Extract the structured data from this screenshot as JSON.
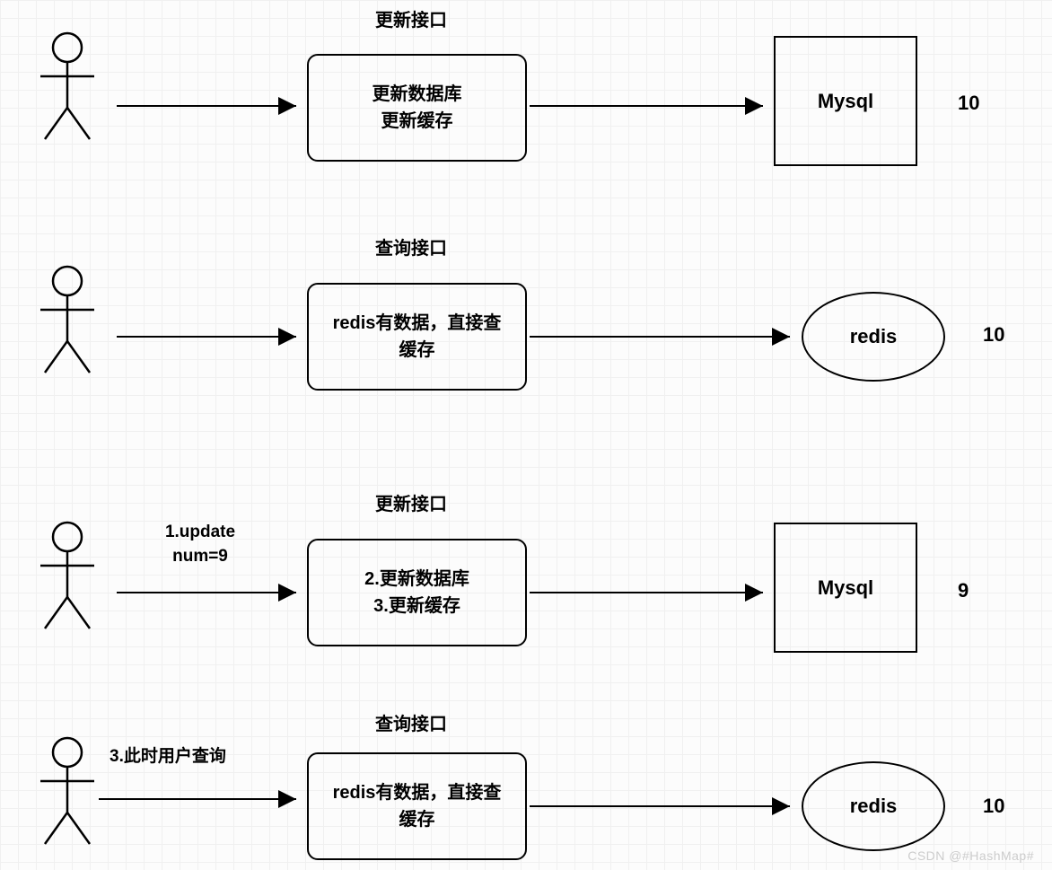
{
  "row1": {
    "title": "更新接口",
    "box": "更新数据库\n更新缓存",
    "target": "Mysql",
    "value": "10"
  },
  "row2": {
    "title": "查询接口",
    "box": "redis有数据，直接查\n缓存",
    "target": "redis",
    "value": "10"
  },
  "row3": {
    "title": "更新接口",
    "arrow_label": "1.update\nnum=9",
    "box": "2.更新数据库\n3.更新缓存",
    "target": "Mysql",
    "value": "9"
  },
  "row4": {
    "title": "查询接口",
    "arrow_label": "3.此时用户查询",
    "box": "redis有数据，直接查\n缓存",
    "target": "redis",
    "value": "10"
  },
  "watermark": "CSDN @#HashMap#"
}
